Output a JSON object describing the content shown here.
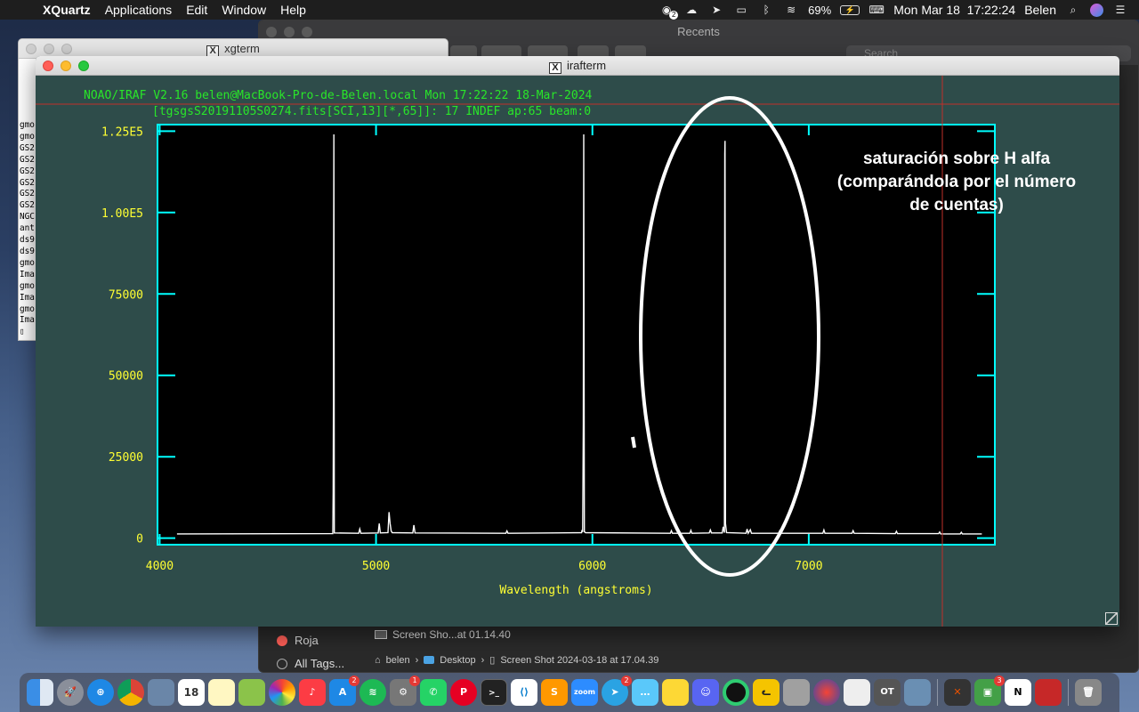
{
  "menubar": {
    "app": "XQuartz",
    "items": [
      "Applications",
      "Edit",
      "Window",
      "Help"
    ],
    "battery": "69%",
    "datetime": "Mon Mar 18  17:22:24",
    "user": "Belen",
    "notification_badge": "2"
  },
  "finder": {
    "title": "Recents",
    "search_placeholder": "Search",
    "tags": [
      {
        "label": "Roja",
        "color": "#ff5f57"
      },
      {
        "label": "All Tags...",
        "color": ""
      }
    ],
    "file_row": "Screen Sho...at 01.14.40",
    "path": {
      "user": "belen",
      "folder": "Desktop",
      "file": "Screen Shot 2024-03-18 at 17.04.39"
    }
  },
  "xgterm": {
    "title": "xgterm",
    "lines": [
      "gmo",
      "gmo",
      "GS2",
      "GS2",
      "GS2",
      "GS2",
      "GS2",
      "GS2",
      "NGC",
      "ant",
      "ds9",
      "ds9",
      "gmo",
      "Ima",
      "gmo",
      "Ima",
      "gmo",
      "Ima",
      "▯"
    ]
  },
  "irafterm": {
    "title": "irafterm",
    "header1": "NOAO/IRAF V2.16 belen@MacBook-Pro-de-Belen.local Mon 17:22:22 18-Mar-2024",
    "header2": "[tgsgsS20191105S0274.fits[SCI,13][*,65]]: 17 INDEF ap:65 beam:0",
    "annotation": [
      "saturación sobre H alfa",
      "(comparándola por el número",
      "de cuentas)"
    ]
  },
  "chart_data": {
    "type": "line",
    "title": "",
    "xlabel": "Wavelength (angstroms)",
    "ylabel": "",
    "xlim": [
      3990,
      7860
    ],
    "ylim": [
      -2000,
      127000
    ],
    "x_ticks": [
      4000,
      5000,
      6000,
      7000
    ],
    "x_tick_labels": [
      "4000",
      "5000",
      "6000",
      "7000"
    ],
    "y_ticks": [
      0,
      25000,
      50000,
      75000,
      100000,
      125000
    ],
    "y_tick_labels": [
      "0",
      "25000",
      "50000",
      "75000",
      "1.00E5",
      "1.25E5"
    ],
    "grid": false,
    "colors": {
      "axes": "#00ffff",
      "text": "#ffff33",
      "header": "#29e629",
      "line": "#ffffff",
      "cursor": "#c0302a",
      "annotation": "#ffffff"
    },
    "series": [
      {
        "values": [
          [
            4080,
            1300
          ],
          [
            4800,
            1400
          ],
          [
            4802,
            14000
          ],
          [
            4803,
            41000
          ],
          [
            4805,
            124000
          ],
          [
            4807,
            1600
          ],
          [
            4920,
            1500
          ],
          [
            4925,
            2800
          ],
          [
            4930,
            1500
          ],
          [
            5010,
            1600
          ],
          [
            5015,
            4500
          ],
          [
            5020,
            1600
          ],
          [
            5055,
            1700
          ],
          [
            5060,
            8000
          ],
          [
            5065,
            4500
          ],
          [
            5070,
            2200
          ],
          [
            5075,
            1700
          ],
          [
            5170,
            1600
          ],
          [
            5175,
            4000
          ],
          [
            5180,
            1600
          ],
          [
            5600,
            1500
          ],
          [
            5605,
            2200
          ],
          [
            5610,
            1500
          ],
          [
            5950,
            1700
          ],
          [
            5952,
            2500
          ],
          [
            5955,
            1900
          ],
          [
            5958,
            35000
          ],
          [
            5960,
            124000
          ],
          [
            5963,
            2000
          ],
          [
            5968,
            1700
          ],
          [
            6360,
            1500
          ],
          [
            6365,
            2300
          ],
          [
            6370,
            1500
          ],
          [
            6450,
            1500
          ],
          [
            6455,
            2400
          ],
          [
            6460,
            1500
          ],
          [
            6540,
            1600
          ],
          [
            6545,
            2500
          ],
          [
            6550,
            1600
          ],
          [
            6600,
            1600
          ],
          [
            6605,
            3500
          ],
          [
            6610,
            1700
          ],
          [
            6612,
            118000
          ],
          [
            6613,
            122000
          ],
          [
            6615,
            4500
          ],
          [
            6620,
            1700
          ],
          [
            6710,
            1500
          ],
          [
            6715,
            2800
          ],
          [
            6720,
            1500
          ],
          [
            6730,
            2600
          ],
          [
            6735,
            1500
          ],
          [
            6860,
            1500
          ],
          [
            6865,
            2200
          ],
          [
            6870,
            1500
          ],
          [
            7065,
            1500
          ],
          [
            7070,
            2500
          ],
          [
            7075,
            1500
          ],
          [
            7200,
            1500
          ],
          [
            7205,
            2300
          ],
          [
            7210,
            1500
          ],
          [
            7400,
            1400
          ],
          [
            7405,
            2100
          ],
          [
            7410,
            1400
          ],
          [
            7600,
            1400
          ],
          [
            7605,
            1900
          ],
          [
            7610,
            1300
          ],
          [
            7700,
            1300
          ],
          [
            7705,
            1800
          ],
          [
            7710,
            1300
          ],
          [
            7800,
            1300
          ]
        ]
      }
    ]
  }
}
